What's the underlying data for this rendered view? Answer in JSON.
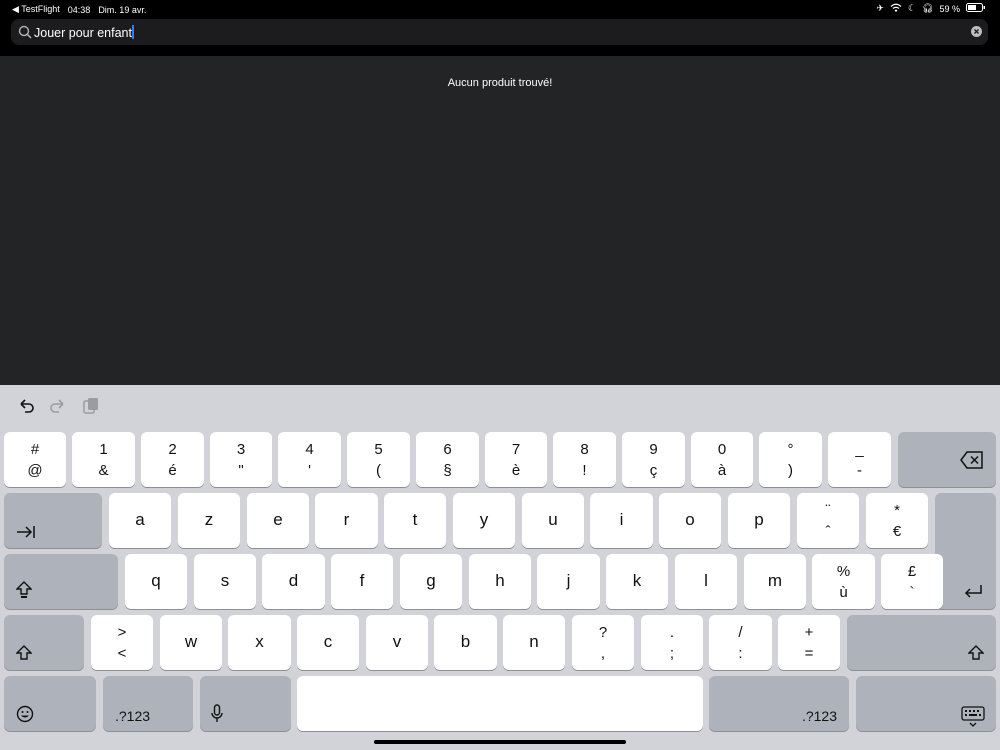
{
  "status": {
    "back_app": "TestFlight",
    "time": "04:38",
    "date": "Dim. 19 avr.",
    "battery": "59 %"
  },
  "search": {
    "value": "Jouer pour enfant"
  },
  "content": {
    "empty_message": "Aucun produit trouvé!"
  },
  "keyboard": {
    "row1": [
      {
        "top": "#",
        "bot": "@"
      },
      {
        "top": "1",
        "bot": "&"
      },
      {
        "top": "2",
        "bot": "é"
      },
      {
        "top": "3",
        "bot": "\""
      },
      {
        "top": "4",
        "bot": "'"
      },
      {
        "top": "5",
        "bot": "("
      },
      {
        "top": "6",
        "bot": "§"
      },
      {
        "top": "7",
        "bot": "è"
      },
      {
        "top": "8",
        "bot": "!"
      },
      {
        "top": "9",
        "bot": "ç"
      },
      {
        "top": "0",
        "bot": "à"
      },
      {
        "top": "°",
        "bot": ")"
      },
      {
        "top": "_",
        "bot": "-"
      }
    ],
    "row2": [
      "a",
      "z",
      "e",
      "r",
      "t",
      "y",
      "u",
      "i",
      "o",
      "p"
    ],
    "row2_extra": [
      {
        "top": "¨",
        "bot": "ˆ"
      },
      {
        "top": "*",
        "bot": "€"
      }
    ],
    "row3": [
      "q",
      "s",
      "d",
      "f",
      "g",
      "h",
      "j",
      "k",
      "l",
      "m"
    ],
    "row3_extra": [
      {
        "top": "%",
        "bot": "ù"
      },
      {
        "top": "£",
        "bot": "`"
      }
    ],
    "row4": [
      {
        "top": ">",
        "bot": "<"
      },
      {
        "top": "w"
      },
      {
        "top": "x"
      },
      {
        "top": "c"
      },
      {
        "top": "v"
      },
      {
        "top": "b"
      },
      {
        "top": "n"
      },
      {
        "top": "?",
        "bot": ","
      },
      {
        "top": ".",
        "bot": ";"
      },
      {
        "top": "/",
        "bot": ":"
      },
      {
        "top": "+",
        "bot": "="
      }
    ],
    "numbers_label": ".?123"
  }
}
